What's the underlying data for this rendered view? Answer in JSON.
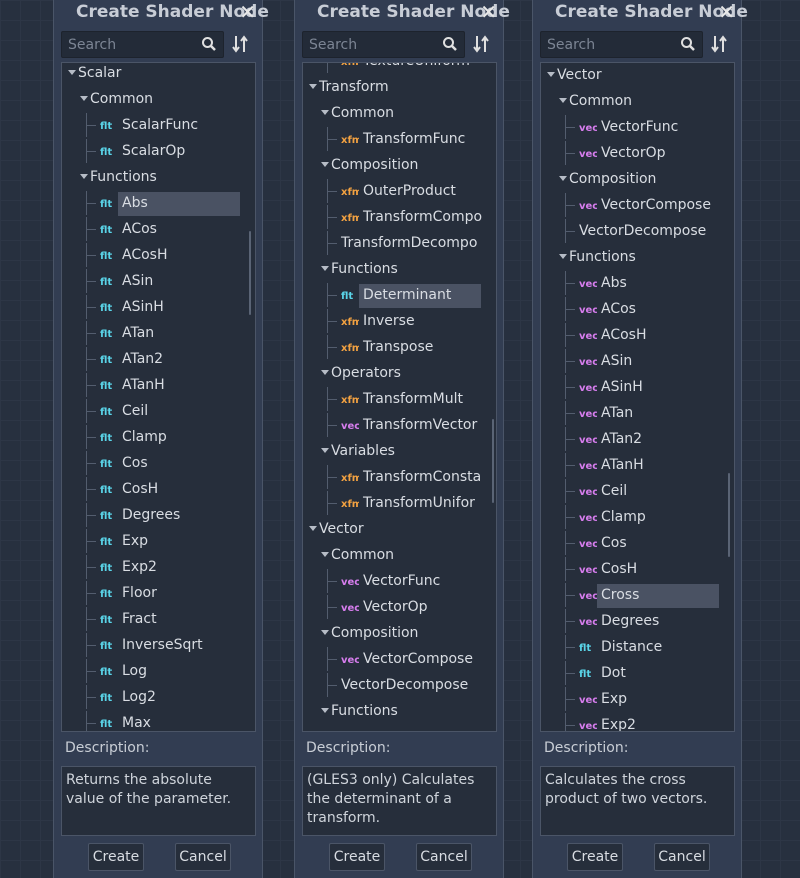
{
  "dialogs": [
    {
      "title": "Create Shader Node",
      "search_placeholder": "Search",
      "description_label": "Description:",
      "description": "Returns the absolute value of the parameter.",
      "create_label": "Create",
      "cancel_label": "Cancel",
      "tree": [
        {
          "label": "Scalar",
          "depth": 0,
          "type": "folder"
        },
        {
          "label": "Common",
          "depth": 1,
          "type": "folder"
        },
        {
          "label": "ScalarFunc",
          "depth": 2,
          "type": "flt"
        },
        {
          "label": "ScalarOp",
          "depth": 2,
          "type": "flt"
        },
        {
          "label": "Functions",
          "depth": 1,
          "type": "folder"
        },
        {
          "label": "Abs",
          "depth": 2,
          "type": "flt",
          "selected": true
        },
        {
          "label": "ACos",
          "depth": 2,
          "type": "flt"
        },
        {
          "label": "ACosH",
          "depth": 2,
          "type": "flt"
        },
        {
          "label": "ASin",
          "depth": 2,
          "type": "flt"
        },
        {
          "label": "ASinH",
          "depth": 2,
          "type": "flt"
        },
        {
          "label": "ATan",
          "depth": 2,
          "type": "flt"
        },
        {
          "label": "ATan2",
          "depth": 2,
          "type": "flt"
        },
        {
          "label": "ATanH",
          "depth": 2,
          "type": "flt"
        },
        {
          "label": "Ceil",
          "depth": 2,
          "type": "flt"
        },
        {
          "label": "Clamp",
          "depth": 2,
          "type": "flt"
        },
        {
          "label": "Cos",
          "depth": 2,
          "type": "flt"
        },
        {
          "label": "CosH",
          "depth": 2,
          "type": "flt"
        },
        {
          "label": "Degrees",
          "depth": 2,
          "type": "flt"
        },
        {
          "label": "Exp",
          "depth": 2,
          "type": "flt"
        },
        {
          "label": "Exp2",
          "depth": 2,
          "type": "flt"
        },
        {
          "label": "Floor",
          "depth": 2,
          "type": "flt"
        },
        {
          "label": "Fract",
          "depth": 2,
          "type": "flt"
        },
        {
          "label": "InverseSqrt",
          "depth": 2,
          "type": "flt"
        },
        {
          "label": "Log",
          "depth": 2,
          "type": "flt"
        },
        {
          "label": "Log2",
          "depth": 2,
          "type": "flt"
        },
        {
          "label": "Max",
          "depth": 2,
          "type": "flt"
        }
      ]
    },
    {
      "title": "Create Shader Node",
      "search_placeholder": "Search",
      "description_label": "Description:",
      "description": "(GLES3 only) Calculates the determinant of a transform.",
      "create_label": "Create",
      "cancel_label": "Cancel",
      "tree": [
        {
          "label": "TextureUniform",
          "depth": 2,
          "type": "tex"
        },
        {
          "label": "Transform",
          "depth": 0,
          "type": "folder"
        },
        {
          "label": "Common",
          "depth": 1,
          "type": "folder"
        },
        {
          "label": "TransformFunc",
          "depth": 2,
          "type": "xfm"
        },
        {
          "label": "Composition",
          "depth": 1,
          "type": "folder"
        },
        {
          "label": "OuterProduct",
          "depth": 2,
          "type": "xfm"
        },
        {
          "label": "TransformCompo",
          "depth": 2,
          "type": "xfm"
        },
        {
          "label": "TransformDecompo",
          "depth": 2,
          "type": "none"
        },
        {
          "label": "Functions",
          "depth": 1,
          "type": "folder"
        },
        {
          "label": "Determinant",
          "depth": 2,
          "type": "flt",
          "selected": true
        },
        {
          "label": "Inverse",
          "depth": 2,
          "type": "xfm"
        },
        {
          "label": "Transpose",
          "depth": 2,
          "type": "xfm"
        },
        {
          "label": "Operators",
          "depth": 1,
          "type": "folder"
        },
        {
          "label": "TransformMult",
          "depth": 2,
          "type": "xfm"
        },
        {
          "label": "TransformVector",
          "depth": 2,
          "type": "vec"
        },
        {
          "label": "Variables",
          "depth": 1,
          "type": "folder"
        },
        {
          "label": "TransformConsta",
          "depth": 2,
          "type": "xfm"
        },
        {
          "label": "TransformUnifor",
          "depth": 2,
          "type": "xfm"
        },
        {
          "label": "Vector",
          "depth": 0,
          "type": "folder"
        },
        {
          "label": "Common",
          "depth": 1,
          "type": "folder"
        },
        {
          "label": "VectorFunc",
          "depth": 2,
          "type": "vec"
        },
        {
          "label": "VectorOp",
          "depth": 2,
          "type": "vec"
        },
        {
          "label": "Composition",
          "depth": 1,
          "type": "folder"
        },
        {
          "label": "VectorCompose",
          "depth": 2,
          "type": "vec"
        },
        {
          "label": "VectorDecompose",
          "depth": 2,
          "type": "none"
        },
        {
          "label": "Functions",
          "depth": 1,
          "type": "folder"
        }
      ]
    },
    {
      "title": "Create Shader Node",
      "search_placeholder": "Search",
      "description_label": "Description:",
      "description": "Calculates the cross product of two vectors.",
      "create_label": "Create",
      "cancel_label": "Cancel",
      "tree": [
        {
          "label": "Vector",
          "depth": 0,
          "type": "folder"
        },
        {
          "label": "Common",
          "depth": 1,
          "type": "folder"
        },
        {
          "label": "VectorFunc",
          "depth": 2,
          "type": "vec"
        },
        {
          "label": "VectorOp",
          "depth": 2,
          "type": "vec"
        },
        {
          "label": "Composition",
          "depth": 1,
          "type": "folder"
        },
        {
          "label": "VectorCompose",
          "depth": 2,
          "type": "vec"
        },
        {
          "label": "VectorDecompose",
          "depth": 2,
          "type": "none"
        },
        {
          "label": "Functions",
          "depth": 1,
          "type": "folder"
        },
        {
          "label": "Abs",
          "depth": 2,
          "type": "vec"
        },
        {
          "label": "ACos",
          "depth": 2,
          "type": "vec"
        },
        {
          "label": "ACosH",
          "depth": 2,
          "type": "vec"
        },
        {
          "label": "ASin",
          "depth": 2,
          "type": "vec"
        },
        {
          "label": "ASinH",
          "depth": 2,
          "type": "vec"
        },
        {
          "label": "ATan",
          "depth": 2,
          "type": "vec"
        },
        {
          "label": "ATan2",
          "depth": 2,
          "type": "vec"
        },
        {
          "label": "ATanH",
          "depth": 2,
          "type": "vec"
        },
        {
          "label": "Ceil",
          "depth": 2,
          "type": "vec"
        },
        {
          "label": "Clamp",
          "depth": 2,
          "type": "vec"
        },
        {
          "label": "Cos",
          "depth": 2,
          "type": "vec"
        },
        {
          "label": "CosH",
          "depth": 2,
          "type": "vec"
        },
        {
          "label": "Cross",
          "depth": 2,
          "type": "vec",
          "selected": true
        },
        {
          "label": "Degrees",
          "depth": 2,
          "type": "vec"
        },
        {
          "label": "Distance",
          "depth": 2,
          "type": "flt"
        },
        {
          "label": "Dot",
          "depth": 2,
          "type": "flt"
        },
        {
          "label": "Exp",
          "depth": 2,
          "type": "vec"
        },
        {
          "label": "Exp2",
          "depth": 2,
          "type": "vec"
        }
      ]
    }
  ],
  "colors": {
    "flt": "#5ad5e9",
    "xfm": "#f3a241",
    "vec": "#d67ded",
    "tex": "#f3a241"
  }
}
